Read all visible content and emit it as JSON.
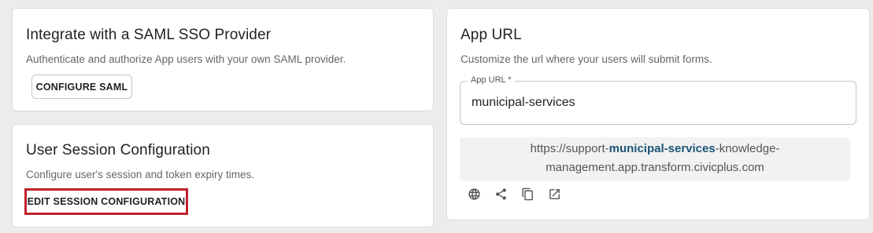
{
  "saml": {
    "title": "Integrate with a SAML SSO Provider",
    "description": "Authenticate and authorize App users with your own SAML provider.",
    "button_label": "CONFIGURE SAML"
  },
  "session": {
    "title": "User Session Configuration",
    "description": "Configure user's session and token expiry times.",
    "button_label": "EDIT SESSION CONFIGURATION",
    "button_highlight_color": "#c0202c"
  },
  "app_url": {
    "title": "App URL",
    "description": "Customize the url where your users will submit forms.",
    "field_label": "App URL *",
    "field_value": "municipal-services",
    "preview": {
      "prefix": "https://support-",
      "highlight": "municipal-services",
      "suffix_line1": "-knowledge-",
      "suffix_line2": "management.app.transform.civicplus.com"
    },
    "icons": [
      "globe-icon",
      "share-icon",
      "copy-icon",
      "open-in-new-icon"
    ]
  },
  "colors": {
    "background": "#ececec",
    "card": "#ffffff",
    "url_highlight": "#1a5576"
  }
}
